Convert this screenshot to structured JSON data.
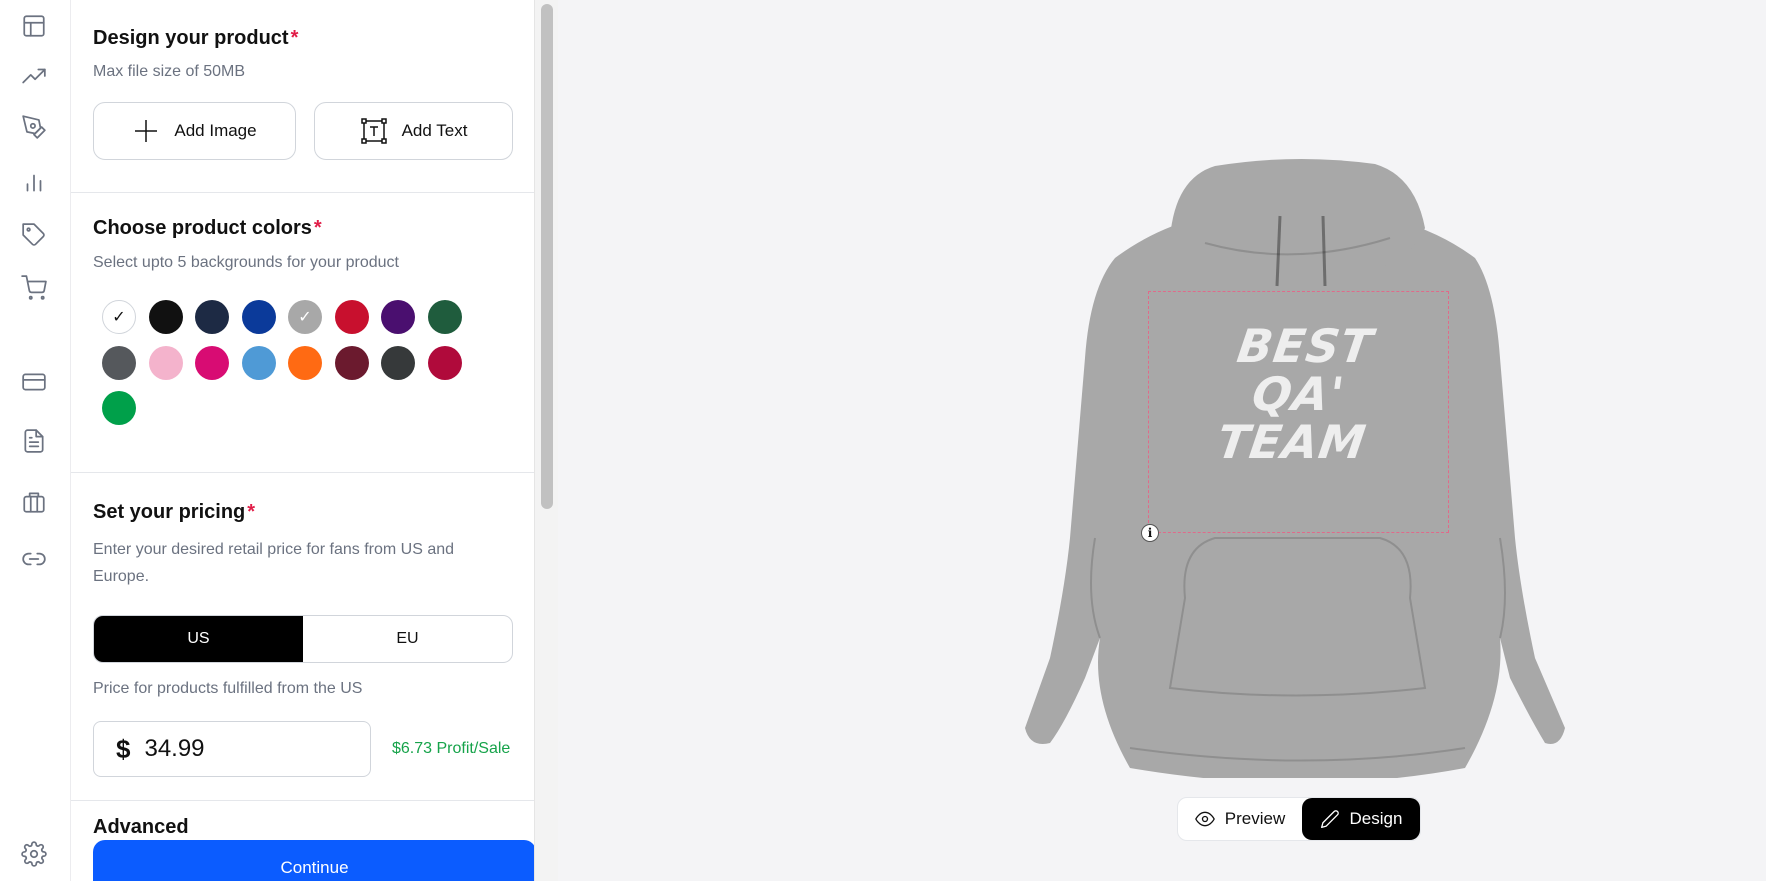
{
  "rail": {
    "icons": [
      "layout-icon",
      "trending-icon",
      "pen-tool-icon",
      "bar-chart-icon",
      "tag-icon",
      "cart-icon",
      "credit-card-icon",
      "document-icon",
      "briefcase-icon",
      "link-icon",
      "settings-icon"
    ]
  },
  "design": {
    "title": "Design your product",
    "required_mark": "*",
    "subtitle": "Max file size of 50MB",
    "add_image_label": "Add Image",
    "add_text_label": "Add Text"
  },
  "colors": {
    "title": "Choose product colors",
    "required_mark": "*",
    "subtitle": "Select upto 5 backgrounds for your product",
    "swatches": [
      {
        "hex": "#ffffff",
        "selected": true
      },
      {
        "hex": "#111111",
        "selected": false
      },
      {
        "hex": "#1d2a44",
        "selected": false
      },
      {
        "hex": "#0b3a9a",
        "selected": false
      },
      {
        "hex": "#a8a8a8",
        "selected": true
      },
      {
        "hex": "#c8102e",
        "selected": false
      },
      {
        "hex": "#4a0f6f",
        "selected": false
      },
      {
        "hex": "#1f5c3d",
        "selected": false
      },
      {
        "hex": "#55585c",
        "selected": false
      },
      {
        "hex": "#f4b3cc",
        "selected": false
      },
      {
        "hex": "#d80c73",
        "selected": false
      },
      {
        "hex": "#4f9ad6",
        "selected": false
      },
      {
        "hex": "#ff6a13",
        "selected": false
      },
      {
        "hex": "#6b1a2e",
        "selected": false
      },
      {
        "hex": "#36393a",
        "selected": false
      },
      {
        "hex": "#b00a3b",
        "selected": false
      },
      {
        "hex": "#00a04a",
        "selected": false
      }
    ]
  },
  "pricing": {
    "title": "Set your pricing",
    "required_mark": "*",
    "subtitle": "Enter your desired retail price for fans from US and Europe.",
    "regions": [
      "US",
      "EU"
    ],
    "active_region": "US",
    "note": "Price for products fulfilled from the US",
    "currency": "$",
    "price": "34.99",
    "profit": "$6.73 Profit/Sale"
  },
  "advanced": {
    "title": "Advanced"
  },
  "continue_label": "Continue",
  "preview": {
    "design_text": [
      "BEST",
      "QA'",
      "TEAM"
    ],
    "info_label": "i",
    "hoodie_color": "#a8a8a8",
    "preview_label": "Preview",
    "design_label": "Design"
  }
}
